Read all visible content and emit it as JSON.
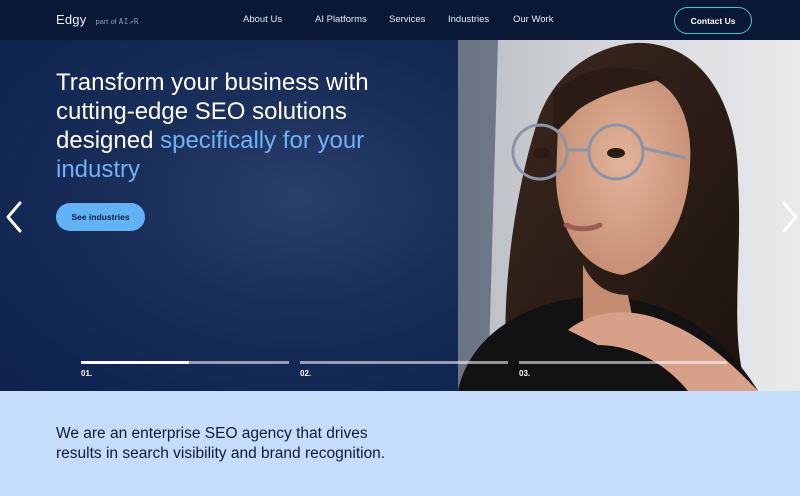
{
  "nav": {
    "brand": "Edgy",
    "brand_part_prefix": "part of",
    "brand_part_name": "AI↗R",
    "links": [
      "About Us",
      "AI Platforms",
      "Services",
      "Industries",
      "Our Work"
    ],
    "contact_label": "Contact Us"
  },
  "hero": {
    "headline_plain": "Transform your business with cutting-edge SEO solutions designed",
    "headline_accent": "specifically for your industry",
    "cta_label": "See industries",
    "steps": [
      {
        "label": "01.",
        "progress": 0.52
      },
      {
        "label": "02.",
        "progress": 0
      },
      {
        "label": "03.",
        "progress": 0
      }
    ],
    "prev_icon": "chevron-left-icon",
    "next_icon": "chevron-right-icon"
  },
  "intro": {
    "text": "We are an enterprise SEO agency that drives results in search visibility and brand recognition."
  },
  "colors": {
    "nav_bg": "#0a1836",
    "hero_bg": "#112552",
    "accent": "#6fb2f5",
    "cta_bg": "#62b3f6",
    "contact_border": "#35d0c8",
    "intro_bg": "#c6dcfb"
  }
}
